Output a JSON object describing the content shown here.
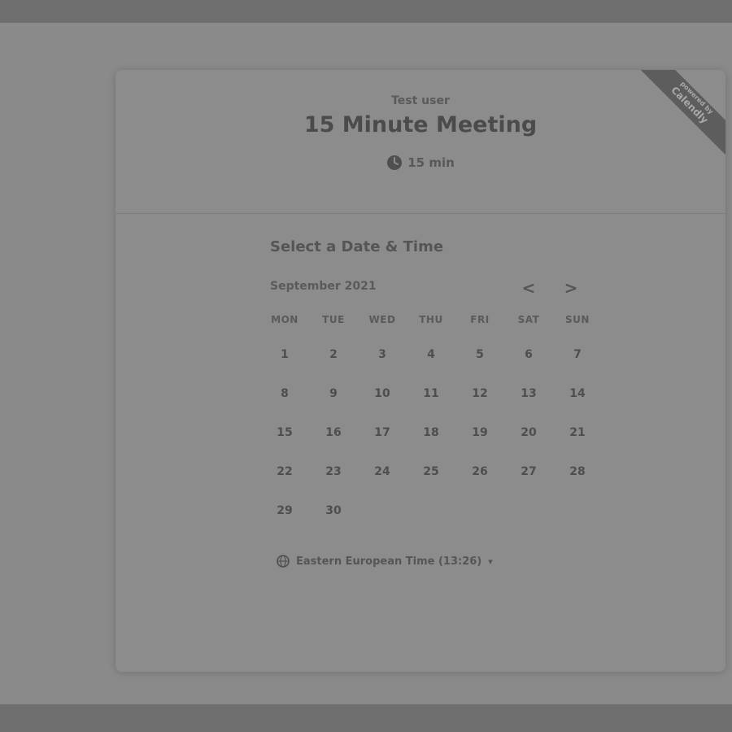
{
  "event": {
    "host": "Test user",
    "title": "15 Minute Meeting",
    "duration": "15 min"
  },
  "badge": {
    "powered_by": "powered by",
    "brand": "Calendly"
  },
  "scheduler": {
    "heading": "Select a Date & Time",
    "month": "September 2021",
    "prev_label": "<",
    "next_label": ">",
    "weekdays": [
      "MON",
      "TUE",
      "WED",
      "THU",
      "FRI",
      "SAT",
      "SUN"
    ],
    "days": [
      {
        "label": "1",
        "available": false
      },
      {
        "label": "2",
        "available": false
      },
      {
        "label": "3",
        "available": false
      },
      {
        "label": "4",
        "available": false
      },
      {
        "label": "5",
        "available": false
      },
      {
        "label": "6",
        "available": false
      },
      {
        "label": "7",
        "available": false
      },
      {
        "label": "8",
        "available": false
      },
      {
        "label": "9",
        "available": false
      },
      {
        "label": "10",
        "available": false
      },
      {
        "label": "11",
        "available": false
      },
      {
        "label": "12",
        "available": false
      },
      {
        "label": "13",
        "available": false
      },
      {
        "label": "14",
        "available": false
      },
      {
        "label": "15",
        "available": false
      },
      {
        "label": "16",
        "available": false
      },
      {
        "label": "17",
        "available": false
      },
      {
        "label": "18",
        "available": false
      },
      {
        "label": "19",
        "available": false
      },
      {
        "label": "20",
        "available": false
      },
      {
        "label": "21",
        "available": false
      },
      {
        "label": "22",
        "available": false
      },
      {
        "label": "23",
        "available": false
      },
      {
        "label": "24",
        "available": false
      },
      {
        "label": "25",
        "available": false
      },
      {
        "label": "26",
        "available": false
      },
      {
        "label": "27",
        "available": false
      },
      {
        "label": "28",
        "available": false
      },
      {
        "label": "29",
        "available": false
      },
      {
        "label": "30",
        "available": false
      },
      {
        "label": "",
        "available": false
      },
      {
        "label": "",
        "available": false
      },
      {
        "label": "",
        "available": false
      },
      {
        "label": "",
        "available": false
      },
      {
        "label": "",
        "available": false
      }
    ],
    "timezone": "Eastern European Time (13:26)",
    "timezone_caret": "▾"
  },
  "colors": {
    "page_bg": "#8a8a8a",
    "card_bg": "#8c8c8c",
    "ribbon_bg": "#5d5d5d"
  }
}
